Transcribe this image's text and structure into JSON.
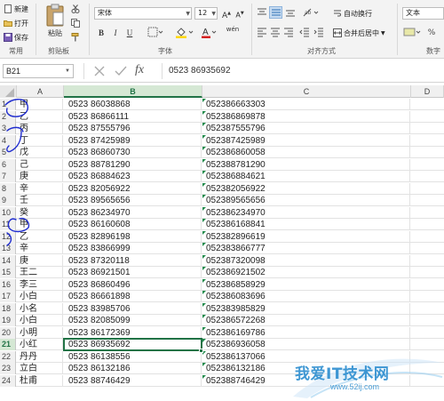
{
  "ribbon": {
    "clipboard": {
      "new_label": "新建",
      "open_label": "打开",
      "save_label": "保存",
      "paste_label": "粘贴",
      "group_label": "剪贴板",
      "common_label": "常用"
    },
    "font": {
      "font_name": "宋体",
      "font_size": "12",
      "bold": "B",
      "italic": "I",
      "underline": "U",
      "wen": "wén",
      "group_label": "字体"
    },
    "alignment": {
      "wrap_label": "自动换行",
      "merge_label": "合并后居中",
      "group_label": "对齐方式"
    },
    "number": {
      "format": "文本",
      "group_label": "数字"
    }
  },
  "formula_bar": {
    "name_box": "B21",
    "fx": "fx",
    "content": "0523  86935692"
  },
  "columns": [
    "A",
    "B",
    "C",
    "D"
  ],
  "selected_row_header": "21",
  "rows": [
    {
      "n": "1",
      "a": "甲",
      "b": "0523  86038868",
      "c": "052386663303"
    },
    {
      "n": "2",
      "a": "乙",
      "b": "0523  86866111",
      "c": "052386869878"
    },
    {
      "n": "3",
      "a": "丙",
      "b": "0523  87555796",
      "c": "052387555796"
    },
    {
      "n": "4",
      "a": "丁",
      "b": "0523  87425989",
      "c": "052387425989"
    },
    {
      "n": "5",
      "a": "戊",
      "b": "0523  86860730",
      "c": "052386860058"
    },
    {
      "n": "6",
      "a": "己",
      "b": "0523  88781290",
      "c": "052388781290"
    },
    {
      "n": "7",
      "a": "庚",
      "b": "0523  86884623",
      "c": "052386884621"
    },
    {
      "n": "8",
      "a": "辛",
      "b": "0523  82056922",
      "c": "052382056922"
    },
    {
      "n": "9",
      "a": "壬",
      "b": "0523  89565656",
      "c": "052389565656"
    },
    {
      "n": "10",
      "a": "癸",
      "b": "0523  86234970",
      "c": "052386234970"
    },
    {
      "n": "11",
      "a": "甲",
      "b": "0523  86160608",
      "c": "052386168841"
    },
    {
      "n": "12",
      "a": "乙",
      "b": "0523  82896198",
      "c": "052382896619"
    },
    {
      "n": "13",
      "a": "辛",
      "b": "0523  83866999",
      "c": "052383866777"
    },
    {
      "n": "14",
      "a": "庚",
      "b": "0523  87320118",
      "c": "052387320098"
    },
    {
      "n": "15",
      "a": "王二",
      "b": "0523  86921501",
      "c": "052386921502"
    },
    {
      "n": "16",
      "a": "李三",
      "b": "0523  86860496",
      "c": "052386858929"
    },
    {
      "n": "17",
      "a": "小白",
      "b": "0523  86661898",
      "c": "052386083696"
    },
    {
      "n": "18",
      "a": "小名",
      "b": "0523  83985706",
      "c": "052383985829"
    },
    {
      "n": "19",
      "a": "小白",
      "b": "0523  82085099",
      "c": "052386572268"
    },
    {
      "n": "20",
      "a": "小明",
      "b": "0523  86172369",
      "c": "052386169786"
    },
    {
      "n": "21",
      "a": "小红",
      "b": "0523  86935692",
      "c": "052386936058"
    },
    {
      "n": "22",
      "a": "丹丹",
      "b": "0523  86138556",
      "c": "052386137066"
    },
    {
      "n": "23",
      "a": "立白",
      "b": "0523  86132186",
      "c": "052386132186"
    },
    {
      "n": "24",
      "a": "杜甫",
      "b": "0523  88746429",
      "c": "052388746429"
    }
  ],
  "watermark": {
    "text": "我爱IT技术网",
    "url": "www.52ij.com"
  },
  "colors": {
    "accent": "#217346",
    "annotation": "#1f2ccf"
  }
}
